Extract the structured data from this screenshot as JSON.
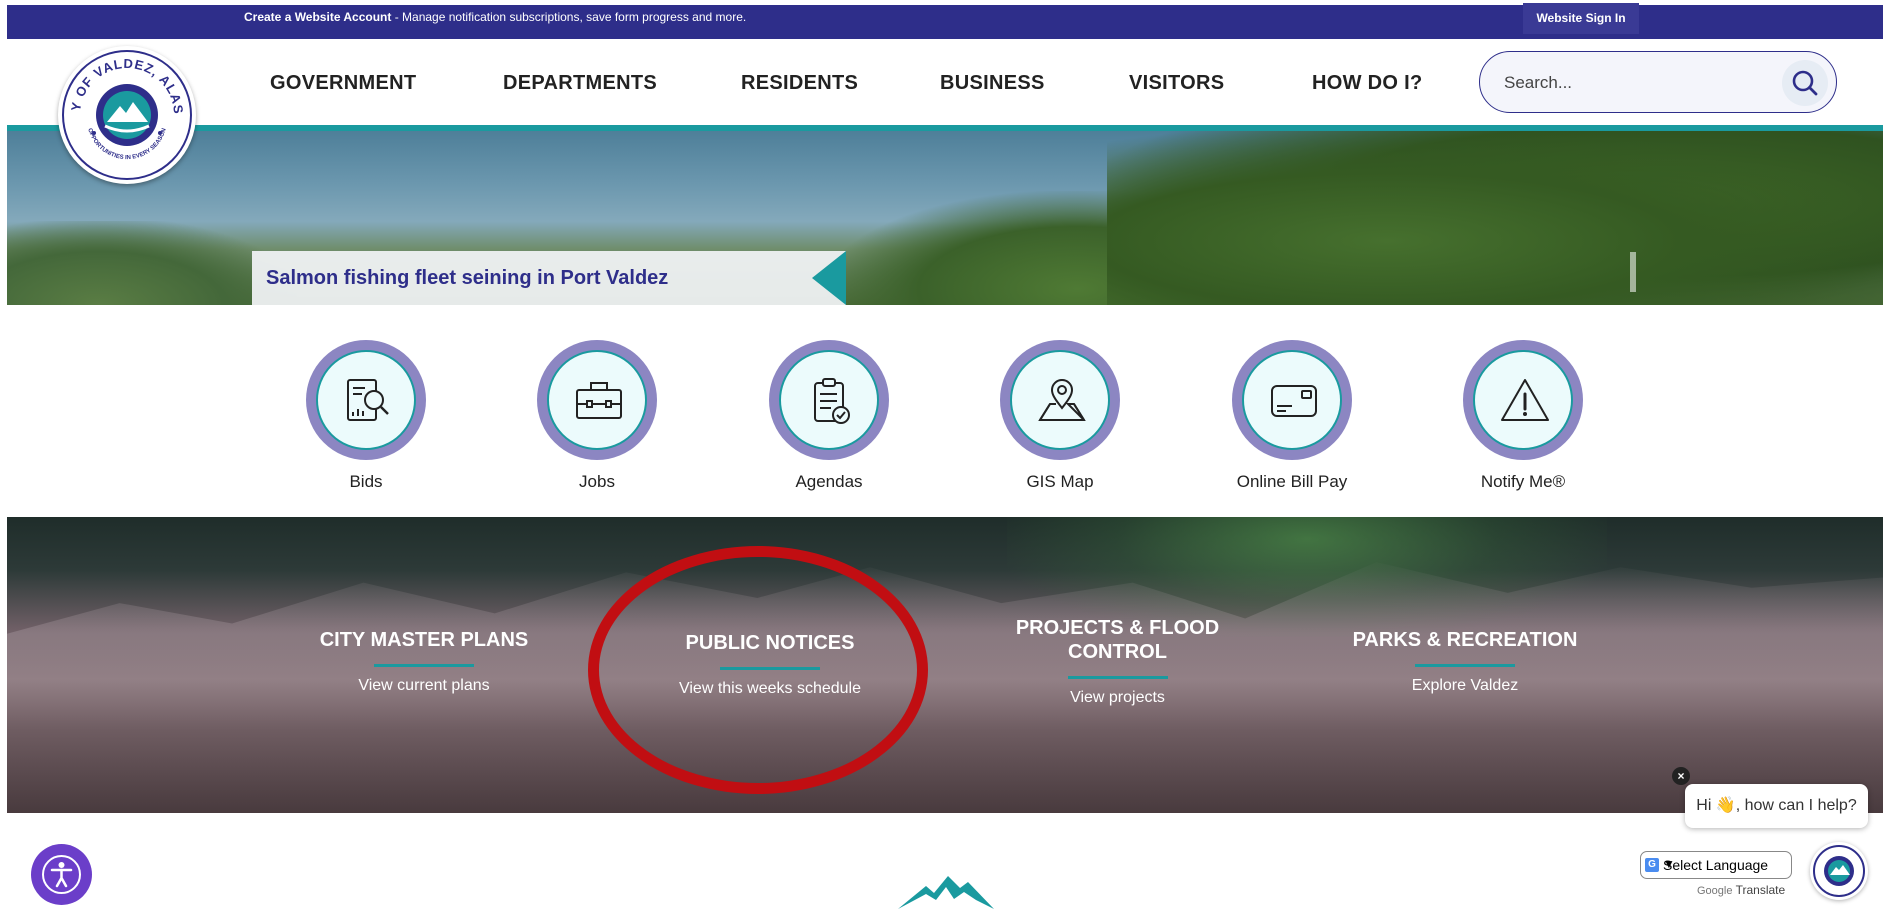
{
  "topbar": {
    "account_link": "Create a Website Account",
    "account_desc": " - Manage notification subscriptions, save form progress and more.",
    "signin": "Website Sign In"
  },
  "logo": {
    "text": "CITY OF VALDEZ, ALASKA",
    "tagline": "OPPORTUNITIES IN EVERY SEASON"
  },
  "nav": {
    "items": [
      "GOVERNMENT",
      "DEPARTMENTS",
      "RESIDENTS",
      "BUSINESS",
      "VISITORS",
      "HOW DO I?"
    ]
  },
  "search": {
    "placeholder": "Search..."
  },
  "hero": {
    "caption": "Salmon fishing fleet seining in Port Valdez"
  },
  "quick_links": [
    {
      "label": "Bids",
      "icon": "document-search-icon"
    },
    {
      "label": "Jobs",
      "icon": "briefcase-icon"
    },
    {
      "label": "Agendas",
      "icon": "clipboard-check-icon"
    },
    {
      "label": "GIS Map",
      "icon": "map-pin-icon"
    },
    {
      "label": "Online Bill Pay",
      "icon": "credit-card-icon"
    },
    {
      "label": "Notify Me®",
      "icon": "warning-icon"
    }
  ],
  "features": [
    {
      "title": "CITY MASTER PLANS",
      "sub": "View current plans"
    },
    {
      "title": "PUBLIC NOTICES",
      "sub": "View this weeks schedule"
    },
    {
      "title_line1": "PROJECTS & FLOOD",
      "title_line2": "CONTROL",
      "sub": "View projects"
    },
    {
      "title": "PARKS & RECREATION",
      "sub": "Explore Valdez"
    }
  ],
  "chat": {
    "greeting": "Hi 👋, how can I help?",
    "close": "×"
  },
  "translate": {
    "select_label": "Select Language",
    "powered_by": "Google",
    "translate": "Translate"
  },
  "colors": {
    "brand_navy": "#2e2e8a",
    "brand_teal": "#1a9a9f",
    "icon_ring": "#8c86c2",
    "annotation_red": "#c10e12"
  }
}
